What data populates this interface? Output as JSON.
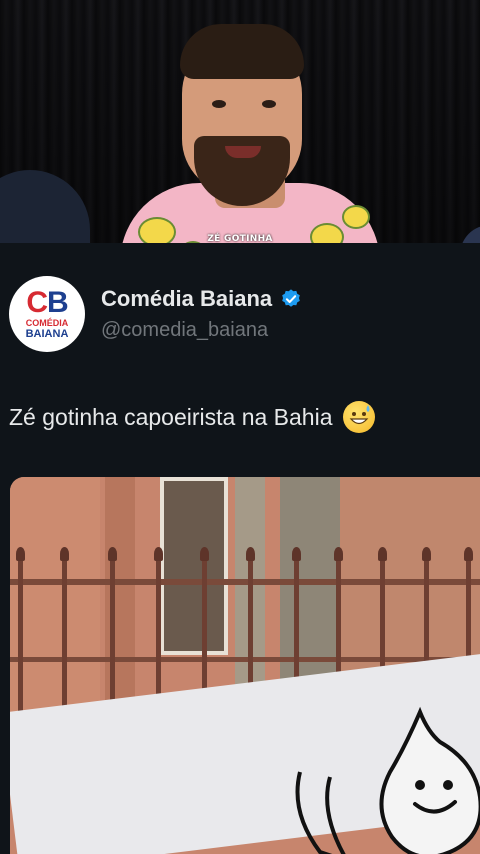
{
  "video": {
    "caption": "ZÉ GOTINHA"
  },
  "account": {
    "display_name": "Comédia Baiana",
    "handle": "@comedia_baiana",
    "verified": true,
    "avatar": {
      "logo_c": "C",
      "logo_b": "B",
      "line1": "COMÉDIA",
      "line2": "BAIANA"
    }
  },
  "tweet": {
    "text": "Zé gotinha capoeirista na Bahia",
    "emoji": "grinning-face-with-sweat"
  },
  "colors": {
    "background": "#0f1419",
    "text_primary": "#e7e9ea",
    "text_secondary": "#71767b",
    "verified_blue": "#1d9bf0",
    "logo_red": "#d62a32",
    "logo_blue": "#1d3f8f"
  }
}
